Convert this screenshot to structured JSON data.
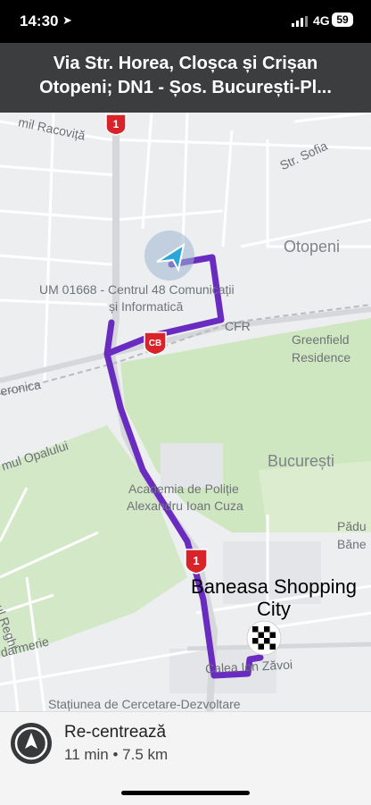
{
  "status_bar": {
    "time": "14:30",
    "location_icon": "location-arrow-icon",
    "signal_icon": "cellular-signal-icon",
    "network": "4G",
    "battery": "59"
  },
  "banner": {
    "line1": "Via Str. Horea, Cloșca și Crișan",
    "line2": "Otopeni; DN1 - Șos. București-Pl..."
  },
  "map": {
    "labels": {
      "racovita": "mil Racoviță",
      "sofia": "Str. Sofia",
      "otopeni": "Otopeni",
      "um": "UM 01668 - Centrul 48 Comunicații",
      "um2": "și Informatică",
      "cfr": "CFR",
      "greenfield": "Greenfield",
      "greenfield2": "Residence",
      "veronica": "eronica",
      "opalului": "mul Opalului",
      "bucuresti": "București",
      "academia": "Academia de Poliție",
      "academia2": "Alexandru Ioan Cuza",
      "padu": "Pădu",
      "bane": "Băne",
      "piscul": "ul Piscul Reghi",
      "darmerie": "darmerie",
      "calea": "Calea Ion Zăvoi",
      "statiunea": "Stațiunea de Cercetare-Dezvoltare",
      "shopping": "Baneasa Shopping",
      "shopping2": "City"
    },
    "shields": {
      "dn1_top": "1",
      "dn1_mid": "1",
      "cb": "CB"
    },
    "colors": {
      "route": "#6a2bc0",
      "green": "#cfe7c1",
      "water": "#c7d7e6"
    }
  },
  "bottom_panel": {
    "recenter_icon": "compass-arrow-icon",
    "title": "Re-centrează",
    "eta": "11 min • 7.5 km"
  }
}
